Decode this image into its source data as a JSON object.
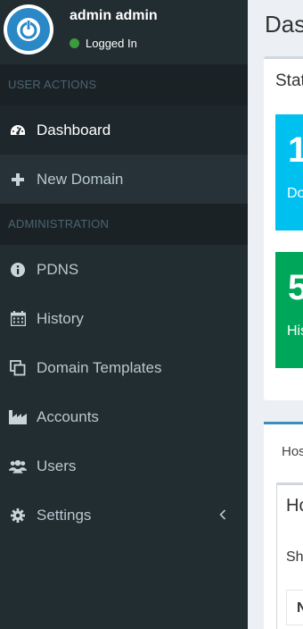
{
  "user": {
    "name": "admin admin",
    "status": "Logged In",
    "status_color": "#3c9b3c"
  },
  "sidebar": {
    "sections": [
      {
        "header": "USER ACTIONS",
        "items": [
          {
            "label": "Dashboard",
            "icon": "dashboard-icon",
            "active": true
          },
          {
            "label": "New Domain",
            "icon": "plus-icon"
          }
        ]
      },
      {
        "header": "ADMINISTRATION",
        "items": [
          {
            "label": "PDNS",
            "icon": "info-circle-icon"
          },
          {
            "label": "History",
            "icon": "calendar-icon"
          },
          {
            "label": "Domain Templates",
            "icon": "clone-icon"
          },
          {
            "label": "Accounts",
            "icon": "industry-icon"
          },
          {
            "label": "Users",
            "icon": "users-icon"
          },
          {
            "label": "Settings",
            "icon": "gear-icon",
            "has_submenu": true
          }
        ]
      }
    ]
  },
  "main": {
    "page_title": "Das",
    "stats_box_title": "Stat",
    "stat1": {
      "value": "1",
      "label": "Do",
      "color": "#00c0ef"
    },
    "stat2": {
      "value": "5",
      "label": "His",
      "color": "#00a65a"
    },
    "tab_label": "Hos",
    "inner_title": "Ho",
    "inner_sub": "Sh",
    "inner_header": "N"
  }
}
